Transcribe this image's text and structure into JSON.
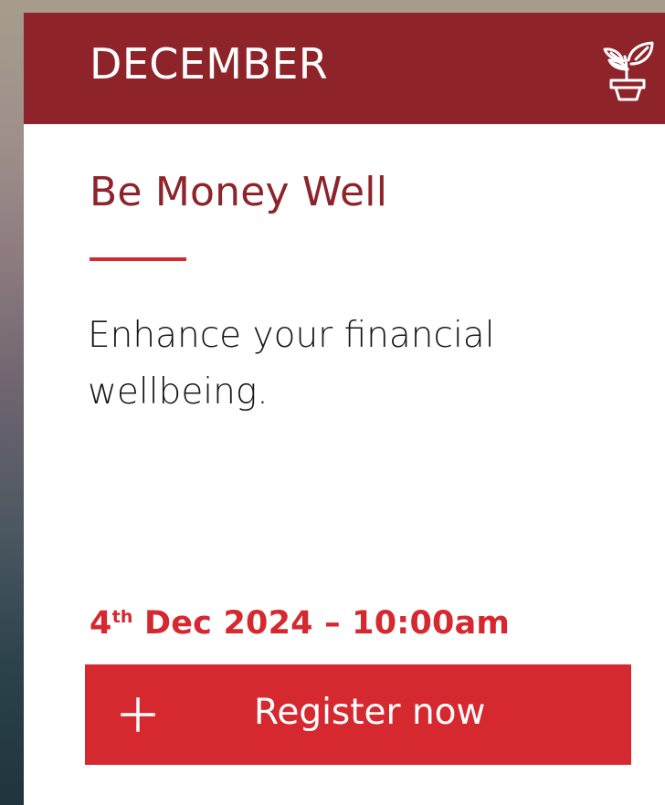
{
  "event_card": {
    "month": "DECEMBER",
    "title": "Be Money Well",
    "description": "Enhance your financial wellbeing.",
    "date": {
      "day_number": "4",
      "day_suffix": "th",
      "rest": " Dec 2024 – 10:00am"
    },
    "register": {
      "label": "Register now",
      "icon": "plus-icon"
    }
  },
  "colors": {
    "header_bg": "#8e232a",
    "title": "#8e232a",
    "accent": "#d5282f",
    "body_text": "#161616",
    "button_text": "#ffffff"
  },
  "icons": {
    "header": "plant-icon"
  }
}
